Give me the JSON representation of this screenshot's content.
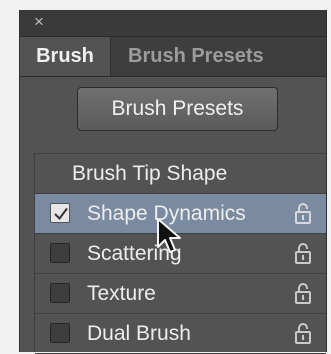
{
  "window": {
    "close_glyph": "×"
  },
  "tabs": [
    {
      "label": "Brush",
      "active": true
    },
    {
      "label": "Brush Presets",
      "active": false
    }
  ],
  "presets_button": {
    "label": "Brush Presets"
  },
  "brush_tip_header": "Brush Tip Shape",
  "options": [
    {
      "label": "Shape Dynamics",
      "checked": true,
      "selected": true,
      "icon": "lock-icon"
    },
    {
      "label": "Scattering",
      "checked": false,
      "selected": false,
      "icon": "lock-icon"
    },
    {
      "label": "Texture",
      "checked": false,
      "selected": false,
      "icon": "lock-icon"
    },
    {
      "label": "Dual Brush",
      "checked": false,
      "selected": false,
      "icon": "lock-icon"
    }
  ],
  "colors": {
    "panel_bg": "#535353",
    "selected_row": "#7a8aa0",
    "text": "#ededed"
  }
}
